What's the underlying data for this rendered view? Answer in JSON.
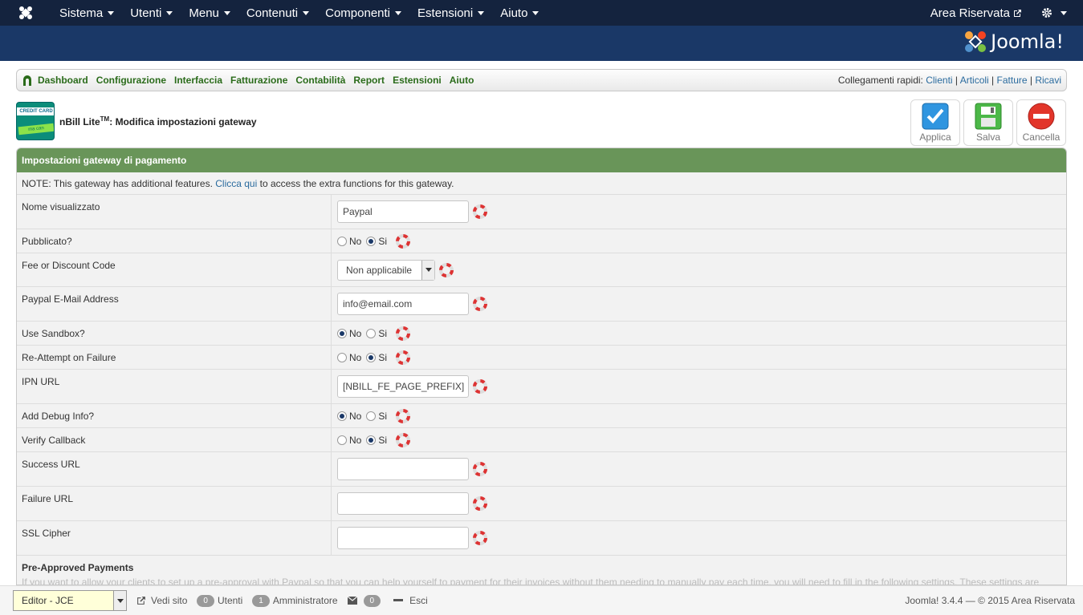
{
  "topnav": {
    "menus": [
      "Sistema",
      "Utenti",
      "Menu",
      "Contenuti",
      "Componenti",
      "Estensioni",
      "Aiuto"
    ],
    "area_riservata": "Area Riservata"
  },
  "header": {
    "brand": "Joomla!"
  },
  "nbill_menu": {
    "items": [
      "Dashboard",
      "Configurazione",
      "Interfaccia",
      "Fatturazione",
      "Contabilità",
      "Report",
      "Estensioni",
      "Aiuto"
    ],
    "quick_label": "Collegamenti rapidi:",
    "quick_links": [
      "Clienti",
      "Articoli",
      "Fatture",
      "Ricavi"
    ]
  },
  "title": {
    "product": "nBill Lite",
    "tm": "TM",
    "text": ": Modifica impostazioni gateway",
    "icon_top": "CREDIT CARD",
    "icon_band": "ma can"
  },
  "toolbar": {
    "apply": "Applica",
    "save": "Salva",
    "cancel": "Cancella"
  },
  "form": {
    "header": "Impostazioni gateway di pagamento",
    "note_pre": "NOTE: This gateway has additional features. ",
    "note_link": "Clicca qui",
    "note_post": " to access the extra functions for this gateway.",
    "labels": {
      "display_name": "Nome visualizzato",
      "published": "Pubblicato?",
      "fee": "Fee or Discount Code",
      "paypal_email": "Paypal E-Mail Address",
      "sandbox": "Use Sandbox?",
      "reattempt": "Re-Attempt on Failure",
      "ipn": "IPN URL",
      "debug": "Add Debug Info?",
      "verify": "Verify Callback",
      "success": "Success URL",
      "failure": "Failure URL",
      "ssl": "SSL Cipher"
    },
    "values": {
      "display_name": "Paypal",
      "fee": "Non applicabile",
      "paypal_email": "info@email.com",
      "ipn": "[NBILL_FE_PAGE_PREFIX]",
      "success": "",
      "failure": "",
      "ssl": ""
    },
    "radio": {
      "no": "No",
      "yes": "Si"
    },
    "preapproved_title": "Pre-Approved Payments",
    "preapproved_text": "If you want to allow your clients to set up a pre-approval with Paypal so that you can help yourself to payment for their invoices without them needing to manually pay each time, you will need to fill in the following settings. These settings are"
  },
  "statusbar": {
    "editor": "Editor - JCE",
    "view_site": "Vedi sito",
    "users_count": "0",
    "users_label": "Utenti",
    "admin_count": "1",
    "admin_label": "Amministratore",
    "msg_count": "0",
    "logout": "Esci",
    "version": "Joomla! 3.4.4  —  © 2015 Area Riservata"
  }
}
